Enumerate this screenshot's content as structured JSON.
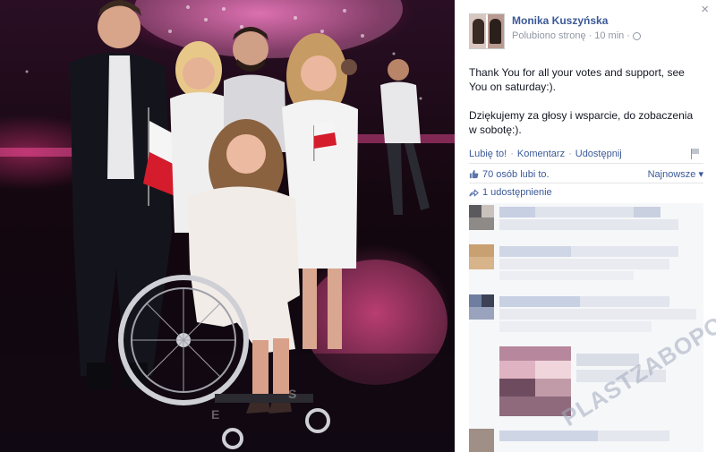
{
  "window": {
    "close_label": "×"
  },
  "post": {
    "author": "Monika Kuszyńska",
    "subtitle": "Polubiono stronę",
    "time": "10 min",
    "paragraphs": [
      "Thank You for all your votes and support, see You on saturday:).",
      "Dziękujemy za głosy i wsparcie, do zobaczenia w sobotę:)."
    ]
  },
  "actions": {
    "like": "Lubię to!",
    "comment": "Komentarz",
    "share": "Udostępnij"
  },
  "stats": {
    "likes": "70 osób lubi to.",
    "sort": "Najnowsze ▾",
    "shares": "1 udostępnienie"
  },
  "watermark": "PLASTZABOPOST",
  "colors": {
    "link": "#3b5998",
    "muted": "#9197a3",
    "panel_bg": "#ffffff",
    "comments_bg": "#f6f7f9"
  },
  "icons": {
    "close": "close-icon",
    "globe": "globe-icon",
    "thumb": "thumbs-up-icon",
    "share": "share-icon",
    "report": "flag-icon"
  }
}
